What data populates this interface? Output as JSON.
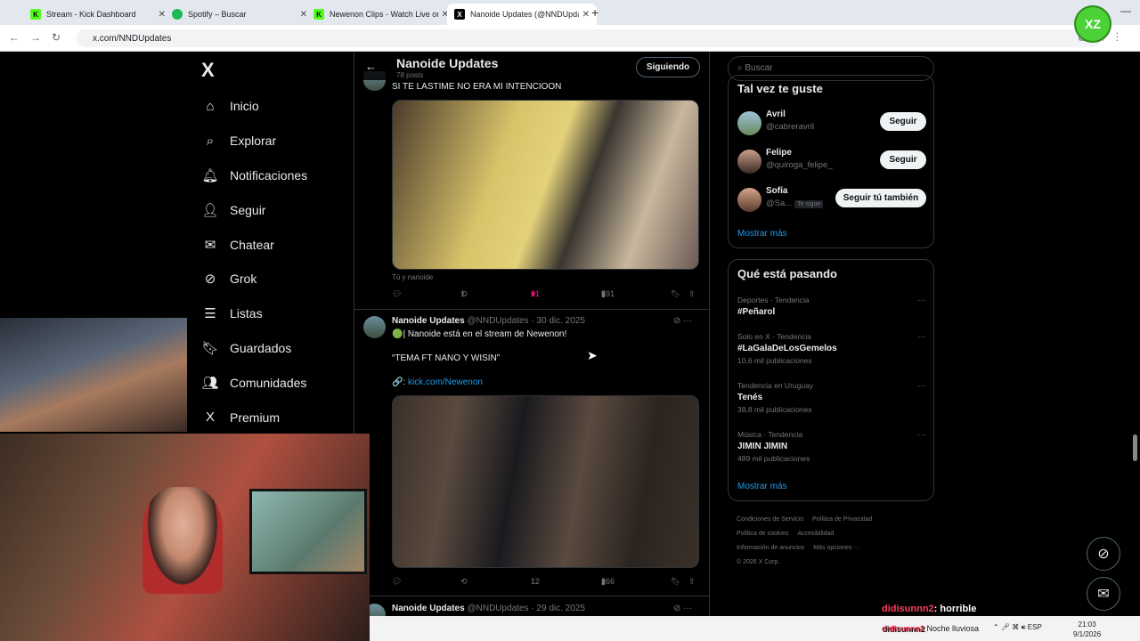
{
  "browser": {
    "tabs": [
      {
        "title": "Stream - Kick Dashboard",
        "favicon": "K",
        "favicon_color": "#53fc18",
        "active": false
      },
      {
        "title": "Spotify – Buscar",
        "favicon": "●",
        "favicon_color": "#1db954",
        "active": false
      },
      {
        "title": "Newenon Clips - Watch Live on",
        "favicon": "K",
        "favicon_color": "#53fc18",
        "active": false
      },
      {
        "title": "Nanoide Updates (@NNDUpdat",
        "favicon": "X",
        "favicon_color": "#000000",
        "active": true
      }
    ],
    "url": "x.com/NNDUpdates",
    "badge": "XZ"
  },
  "sidebar": {
    "logo": "X",
    "items": [
      {
        "label": "Inicio",
        "icon": "⌂",
        "icon_name": "home-icon"
      },
      {
        "label": "Explorar",
        "icon": "⌕",
        "icon_name": "search-icon"
      },
      {
        "label": "Notificaciones",
        "icon": "🔔︎",
        "icon_name": "bell-icon"
      },
      {
        "label": "Seguir",
        "icon": "👤︎",
        "icon_name": "follow-icon"
      },
      {
        "label": "Chatear",
        "icon": "✉",
        "icon_name": "mail-icon"
      },
      {
        "label": "Grok",
        "icon": "⊘",
        "icon_name": "grok-icon"
      },
      {
        "label": "Listas",
        "icon": "☰",
        "icon_name": "list-icon"
      },
      {
        "label": "Guardados",
        "icon": "🔖︎",
        "icon_name": "bookmark-icon"
      },
      {
        "label": "Comunidades",
        "icon": "👥︎",
        "icon_name": "communities-icon"
      },
      {
        "label": "Premium",
        "icon": "X",
        "icon_name": "premium-icon"
      }
    ]
  },
  "header": {
    "name": "Nanoide Updates",
    "posts": "78 posts",
    "follow_label": "Siguiendo"
  },
  "tweets": [
    {
      "text": "SI TE LASTIME NO ERA MI INTENCIOON",
      "caption": "Tú y nanoide",
      "replies": "",
      "retweets": "1",
      "likes": "21",
      "views": "591"
    },
    {
      "name": "Nanoide Updates",
      "handle": "@NNDUpdates · 30 dic. 2025",
      "line1": "🟢| Nanoide está en el stream de Newenon!",
      "line2": "“TEMA FT NANO Y WISIN”",
      "link_prefix": "🔗:",
      "link": "kick.com/Newenon",
      "replies": "",
      "retweets": "",
      "likes": "12",
      "views": "266"
    },
    {
      "name": "Nanoide Updates",
      "handle": "@NNDUpdates · 29 dic. 2025"
    }
  ],
  "right": {
    "search_placeholder": "Buscar",
    "who_title": "Tal vez te guste",
    "who": [
      {
        "name": "Avril",
        "handle": "@cabreravril",
        "button": "Seguir",
        "tag": ""
      },
      {
        "name": "Felipe",
        "handle": "@quiroga_felipe_",
        "button": "Seguir",
        "tag": ""
      },
      {
        "name": "Sofía",
        "handle": "@Sa...",
        "button": "Seguir tú también",
        "tag": "Te sigue"
      }
    ],
    "who_more": "Mostrar más",
    "trends_title": "Qué está pasando",
    "trends": [
      {
        "category": "Deportes · Tendencia",
        "title": "#Peñarol",
        "count": ""
      },
      {
        "category": "Solo en X · Tendencia",
        "title": "#LaGalaDeLosGemelos",
        "count": "10,6 mil publicaciones"
      },
      {
        "category": "Tendencia en Uruguay",
        "title": "Tenés",
        "count": "38,8 mil publicaciones"
      },
      {
        "category": "Música · Tendencia",
        "title": "JIMIN JIMIN",
        "count": "489 mil publicaciones"
      }
    ],
    "trends_more": "Mostrar más",
    "footer": [
      "Condiciones de Servicio",
      "Política de Privacidad",
      "Política de cookies",
      "Accesibilidad",
      "Información de anuncios",
      "Más opciones ···",
      "© 2026 X Corp."
    ]
  },
  "overlay": {
    "chat1_user": "didisunnn2",
    "chat1_msg": ": horrible",
    "chat2_user": "didisunnn2",
    "chat2_msg": "Noche lluviosa"
  },
  "taskbar": {
    "lang": "ESP",
    "time": "21:03",
    "date": "9/1/2026"
  }
}
